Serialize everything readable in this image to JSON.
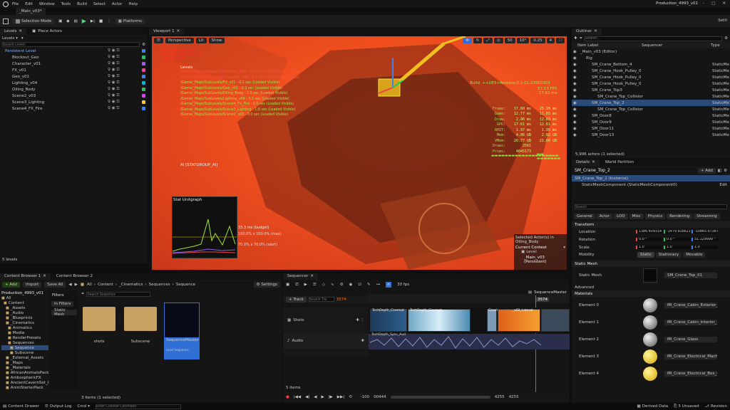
{
  "menu": {
    "items": [
      "File",
      "Edit",
      "Window",
      "Tools",
      "Build",
      "Select",
      "Actor",
      "Help"
    ],
    "level_tab": "_Main_v03*",
    "project": "Production_4993_v01"
  },
  "toolbar": {
    "mode": "Selection Mode",
    "platforms": "Platforms",
    "settings": "Setti"
  },
  "left_panel": {
    "tab_levels": "Levels",
    "tab_place": "Place Actors",
    "search_placeholder": "Search Levels",
    "tree": [
      {
        "label": "Persistent Level",
        "color": "#3b82f6",
        "active": true
      },
      {
        "label": "Blockout_Geo",
        "color": "#22c55e"
      },
      {
        "label": "Character_v01",
        "color": "#a855f7"
      },
      {
        "label": "FX_v01",
        "color": "#ec4899"
      },
      {
        "label": "Geo_v01",
        "color": "#3b82f6"
      },
      {
        "label": "Lighting_v04",
        "color": "#06b6d4"
      },
      {
        "label": "Oiling_Body",
        "color": "#22c55e"
      },
      {
        "label": "Scene2_v03",
        "color": "#d946ef"
      },
      {
        "label": "Scene3_Lighting",
        "color": "#facc15"
      },
      {
        "label": "Scene4_FX_Fire",
        "color": "#3b82f6"
      }
    ],
    "footer": "5 levels"
  },
  "viewport": {
    "tab": "Viewport 1",
    "perspective": "Perspective",
    "lit": "Lit",
    "show": "Show",
    "toolbar_values": [
      "50",
      "10°",
      "0.25",
      "4"
    ],
    "levels_title": "Levels",
    "levels_lines": [
      "/Game/_Maps/SubLevels/Blockout_Geo - 0.2 sec (Loaded Not Visible)",
      "/Game/_Maps/SubLevels/Character_v01 - 0.2 sec (Loaded Not Visible)",
      "/Game/_Maps/SubLevels/FX_v01 - 0.1 sec (Loaded Visible)",
      "/Game/_Maps/SubLevels/Geo_v01 - 0.3 sec (Loaded Visible)",
      "/Game/_Maps/SubLevels/Oiling_Body - 1.5 sec (Loaded Visible)",
      "/Game/_Maps/SubLevels/Lighting_v04 - 0.1 sec (Loaded Visible)",
      "/Game/_Maps/SubLevels/Scene4_FX_Fire - 0.0 sec (Loaded Visible)",
      "/Game/_Maps/SubLevels/Scene3_Lighting - 1.8 sec (Loaded Visible)",
      "/Game/_Maps/SubLevels/Scene2_v03 - 0.0 sec (Loaded Visible)"
    ],
    "build": "Build: ++UE5+Release-5.1-CL-23901901",
    "fps": "57.13 FPS",
    "ms": "17.62 ms",
    "stats": [
      [
        "Frame:",
        "17.60 ms",
        "25.28 ms"
      ],
      [
        "Game:",
        "12.77 ms",
        "11.85 ms"
      ],
      [
        "Draw:",
        "2.96 ms",
        "12.69 ms"
      ],
      [
        "GPU:",
        "17.61 ms",
        "12.61 ms"
      ],
      [
        "RHIT:",
        "1.97 ms",
        "1.95 ms"
      ],
      [
        "Mem:",
        "4.06 GB",
        "2.82 GB"
      ],
      [
        "VMem:",
        "20.77 GB",
        "21.00 GB"
      ],
      [
        "Draws:",
        "2561",
        ""
      ],
      [
        "Prims:",
        "4045173",
        ""
      ]
    ],
    "stat_group": "AI [STATGROUP_AI]",
    "graph_title": "Stat Unitgraph",
    "budget": "33.3 ms (budget)",
    "budget2": "100.0% x 100.0% (max)",
    "budget3": "70.0% x 70.0% (alert)",
    "selected": "Selected Actor(s) in",
    "selected2": "Oiling_Body",
    "context": "Current Context",
    "level": "Level",
    "main_level": "_Main_v03 (Persistent)"
  },
  "outliner": {
    "tab": "Outliner",
    "search_placeholder": "Search...",
    "col_label": "Item Label",
    "col_seq": "Sequencer",
    "col_type": "Type",
    "rows": [
      {
        "label": "_Main_v03 (Editor)",
        "type": "",
        "indent": 0
      },
      {
        "label": "Rig",
        "type": "",
        "indent": 1
      },
      {
        "label": "SM_Crane_Bottom_4",
        "type": "StaticMe",
        "indent": 2
      },
      {
        "label": "SM_Crane_Hook_Pulley_0",
        "type": "StaticMe",
        "indent": 2
      },
      {
        "label": "SM_Crane_Hook_Pulley_0",
        "type": "StaticMe",
        "indent": 2
      },
      {
        "label": "SM_Crane_Hook_Pulley_0",
        "type": "StaticMe",
        "indent": 2
      },
      {
        "label": "SM_Crane_Top3",
        "type": "StaticMe",
        "indent": 2
      },
      {
        "label": "SM_Crane_Top_Collisior",
        "type": "StaticMe",
        "indent": 3
      },
      {
        "label": "SM_Crane_Top_2",
        "type": "StaticMe",
        "indent": 2,
        "selected": true
      },
      {
        "label": "SM_Crane_Top_Collisior",
        "type": "StaticMe",
        "indent": 3
      },
      {
        "label": "SM_Door8",
        "type": "StaticMe",
        "indent": 2
      },
      {
        "label": "SM_Door9",
        "type": "StaticMe",
        "indent": 2
      },
      {
        "label": "SM_Door11",
        "type": "StaticMe",
        "indent": 2
      },
      {
        "label": "SM_Door13",
        "type": "StaticMe",
        "indent": 2
      }
    ],
    "footer": "5,996 actors (1 selected)"
  },
  "details": {
    "tab": "Details",
    "tab2": "World Partition",
    "name": "SM_Crane_Top_2",
    "add": "+ Add",
    "instance": "SM_Crane_Top_2 (Instance)",
    "component": "StaticMeshComponent (StaticMeshComponent0)",
    "edit": "Edit",
    "search_placeholder": "Search",
    "filters": [
      "General",
      "Actor",
      "LOD",
      "Misc",
      "Physics",
      "Rendering",
      "Streaming"
    ],
    "transform": "Transform",
    "location": "Location",
    "rotation": "Rotation",
    "scale": "Scale",
    "mobility": "Mobility",
    "loc": [
      "1386.409314",
      "-1479.918621",
      "-10865.97387"
    ],
    "rot": [
      "0.0 °",
      "0.0 °",
      "31.129999 °"
    ],
    "scl": [
      "1.0",
      "1.0",
      "1.0"
    ],
    "mob": [
      "Static",
      "Stationary",
      "Movable"
    ],
    "static_mesh_header": "Static Mesh",
    "static_mesh_label": "Static Mesh",
    "static_mesh_value": "SM_Crane_Top_01",
    "advanced": "Advanced",
    "materials": "Materials",
    "elements": [
      [
        "Element 0",
        "MI_Crane_Cabin_Exterior_01"
      ],
      [
        "Element 1",
        "MI_Crane_Cabin_Interior_01"
      ],
      [
        "Element 2",
        "MI_Crane_Glass"
      ],
      [
        "Element 3",
        "MI_Crane_Electrical_Machinery_01"
      ],
      [
        "Element 4",
        "MI_Crane_Electrical_Box_01"
      ]
    ]
  },
  "content": {
    "tab1": "Content Browser 1",
    "tab2": "Content Browser 2",
    "add": "+ Add",
    "import": "Import",
    "save_all": "Save All",
    "settings": "Settings",
    "path": [
      "All",
      "Content",
      "_Cinematics",
      "Sequences",
      "Sequence"
    ],
    "project": "Production_4993_v01",
    "search_placeholder": "Search Sequence",
    "filters_title": "Filters",
    "filter1": "In Filters",
    "filter2": "Static Mesh",
    "tree": [
      "All",
      "Content",
      "_Assets",
      "_Audio",
      "_Blueprints",
      "_Cinematics",
      "Animatics",
      "Media",
      "RenderPresets",
      "Sequences",
      "Sequence",
      "Subscene",
      "_External_Assets",
      "_Maps",
      "_Materials",
      "AfricanAnimalsPack",
      "AmbosphericFX",
      "AncientCavernSet_I",
      "AnimStarterPack"
    ],
    "assets": [
      {
        "name": "shots",
        "kind": "folder"
      },
      {
        "name": "Subscene",
        "kind": "folder"
      },
      {
        "name": "SequenceMaster",
        "kind": "seq",
        "sub": "Level Sequence"
      }
    ],
    "footer": "3 items (1 selected)",
    "collections": "Collections"
  },
  "sequencer": {
    "tab": "Sequencer",
    "fps": "30 fps",
    "master": "SequenceMaster",
    "track": "+ Track",
    "search_placeholder": "Search Tra",
    "frame": "3574",
    "playhead": "3574",
    "tracks": [
      "Shots",
      "Audio"
    ],
    "clip1": "TechDepth_Cinemat",
    "clip2": "TechDepth_Cinemat",
    "clip3": "Cinem",
    "clip4": "_v02_Lateral",
    "audio_clip": "TechDepth_Sync_Aud",
    "items": "5 items",
    "range_start": "-100",
    "range_mid": "00444",
    "range_end": "4255",
    "range_end2": "4255"
  },
  "statusbar": {
    "drawer": "Content Drawer",
    "output": "Output Log",
    "cmd": "Cmd",
    "console_placeholder": "Enter Console Command",
    "derived": "Derived Data",
    "unsaved": "5 Unsaved",
    "revision": "Revision"
  }
}
